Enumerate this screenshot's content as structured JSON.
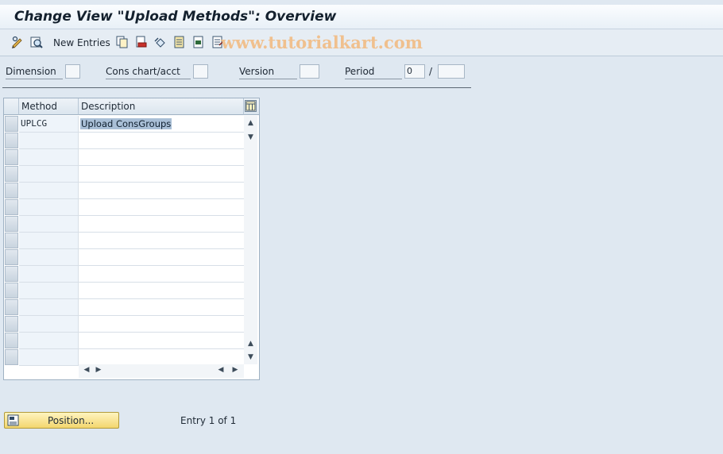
{
  "window": {
    "title": "Change View \"Upload Methods\": Overview"
  },
  "toolbar": {
    "icons": [
      "display-change-icon",
      "details-icon",
      "copy-icon",
      "delete-icon",
      "undo-icon",
      "select-all-icon",
      "select-block-icon",
      "deselect-all-icon"
    ],
    "new_entries_label": "New Entries",
    "watermark": "www.tutorialkart.com"
  },
  "filters": {
    "dimension_label": "Dimension",
    "dimension_value": "",
    "cons_chart_label": "Cons chart/acct",
    "cons_chart_value": "",
    "version_label": "Version",
    "version_value": "",
    "period_label": "Period",
    "period_value": "0",
    "period_separator": "/",
    "year_value": ""
  },
  "table": {
    "columns": [
      "Method",
      "Description"
    ],
    "rows": [
      {
        "method": "UPLCG",
        "description": "Upload ConsGroups"
      }
    ],
    "empty_rows": 14
  },
  "footer": {
    "position_button_label": "Position...",
    "entry_info": "Entry 1 of 1"
  },
  "colors": {
    "background": "#dfe8f1",
    "selection": "#a9bfd6",
    "position_button": "#f3d66e"
  }
}
